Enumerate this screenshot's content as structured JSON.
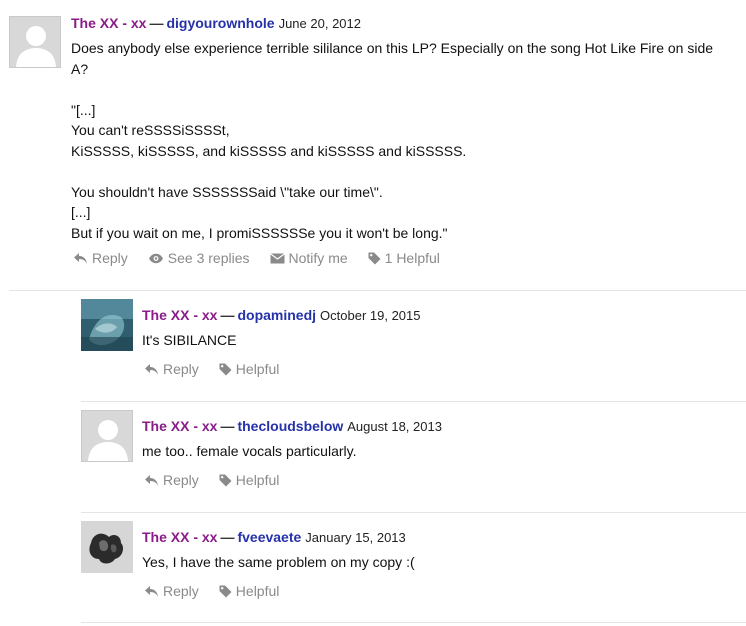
{
  "comments": [
    {
      "release": "The XX - xx",
      "separator": "—",
      "user": "digyourownhole",
      "date": "June 20, 2012",
      "body": "Does anybody else experience terrible sililance on this LP? Especially on the song Hot Like Fire on side A?\n\n\"[...]\nYou can't reSSSSiSSSSt,\nKiSSSSS, kiSSSSS, and kiSSSSS and kiSSSSS and kiSSSSS.\n\nYou shouldn't have SSSSSSSaid \\\"take our time\\\".\n[...]\nBut if you wait on me, I promiSSSSSSe you it won't be long.\"",
      "actions": {
        "reply": "Reply",
        "replies": "See 3 replies",
        "notify": "Notify me",
        "helpful": "1 Helpful"
      }
    }
  ],
  "replies": [
    {
      "release": "The XX - xx",
      "separator": "—",
      "user": "dopaminedj",
      "date": "October 19, 2015",
      "body": "It's SIBILANCE",
      "actions": {
        "reply": "Reply",
        "helpful": "Helpful"
      }
    },
    {
      "release": "The XX - xx",
      "separator": "—",
      "user": "thecloudsbelow",
      "date": "August 18, 2013",
      "body": "me too.. female vocals particularly.",
      "actions": {
        "reply": "Reply",
        "helpful": "Helpful"
      }
    },
    {
      "release": "The XX - xx",
      "separator": "—",
      "user": "fveevaete",
      "date": "January 15, 2013",
      "body": "Yes, I have the same problem on my copy :(",
      "actions": {
        "reply": "Reply",
        "helpful": "Helpful"
      }
    }
  ],
  "colors": {
    "release": "#8a1c8a",
    "user": "#2532a8",
    "action": "#8a8a8a",
    "divider": "#e4e4e4"
  },
  "icons": [
    "user-silhouette-icon",
    "reply-arrow-icon",
    "eye-icon",
    "envelope-icon",
    "tag-icon"
  ]
}
